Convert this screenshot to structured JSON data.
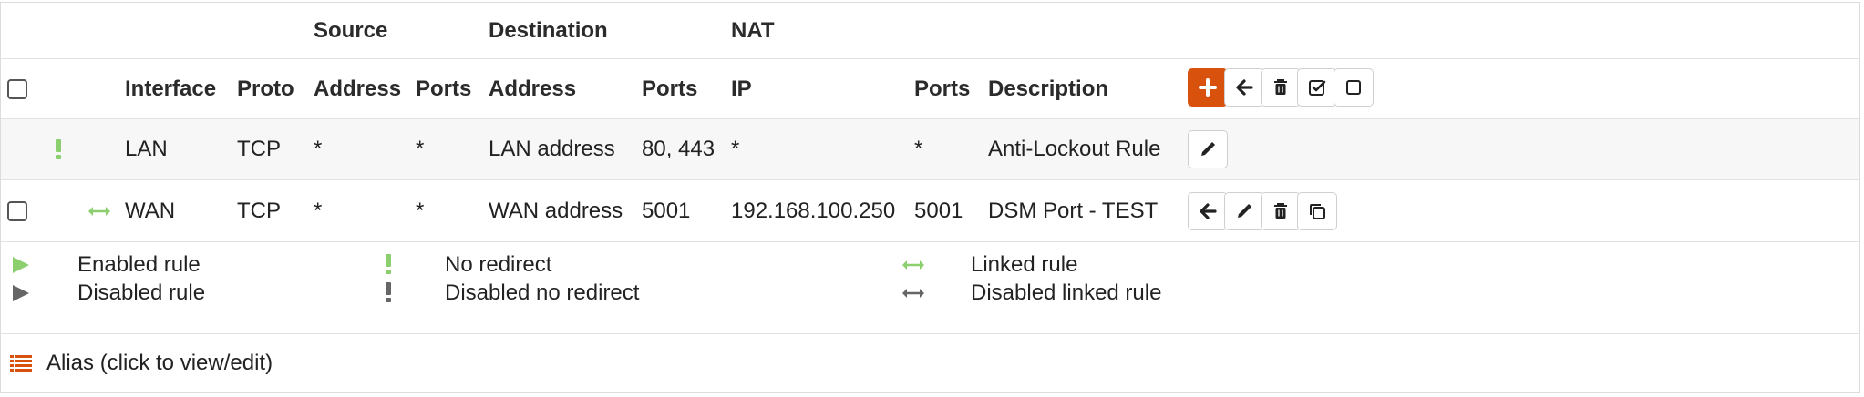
{
  "colors": {
    "accent": "#d8520e",
    "enabled": "#8ccf6e",
    "disabled": "#666666"
  },
  "group_headers": {
    "source": "Source",
    "destination": "Destination",
    "nat": "NAT"
  },
  "columns": {
    "interface": "Interface",
    "proto": "Proto",
    "src_address": "Address",
    "src_ports": "Ports",
    "dst_address": "Address",
    "dst_ports": "Ports",
    "nat_ip": "IP",
    "nat_ports": "Ports",
    "description": "Description"
  },
  "rules": [
    {
      "interface": "LAN",
      "proto": "TCP",
      "src_address": "*",
      "src_ports": "*",
      "dst_address": "LAN address",
      "dst_ports": "80, 443",
      "nat_ip": "*",
      "nat_ports": "*",
      "description": "Anti-Lockout Rule",
      "status_icon": "no-redirect-icon"
    },
    {
      "interface": "WAN",
      "proto": "TCP",
      "src_address": "*",
      "src_ports": "*",
      "dst_address": "WAN address",
      "dst_ports": "5001",
      "nat_ip": "192.168.100.250",
      "nat_ports": "5001",
      "description": "DSM Port - TEST",
      "status_icon": "linked-rule-icon"
    }
  ],
  "legend": {
    "enabled_rule": "Enabled rule",
    "disabled_rule": "Disabled rule",
    "no_redirect": "No redirect",
    "disabled_no_redirect": "Disabled no redirect",
    "linked_rule": "Linked rule",
    "disabled_linked_rule": "Disabled linked rule",
    "alias": "Alias (click to view/edit)"
  }
}
